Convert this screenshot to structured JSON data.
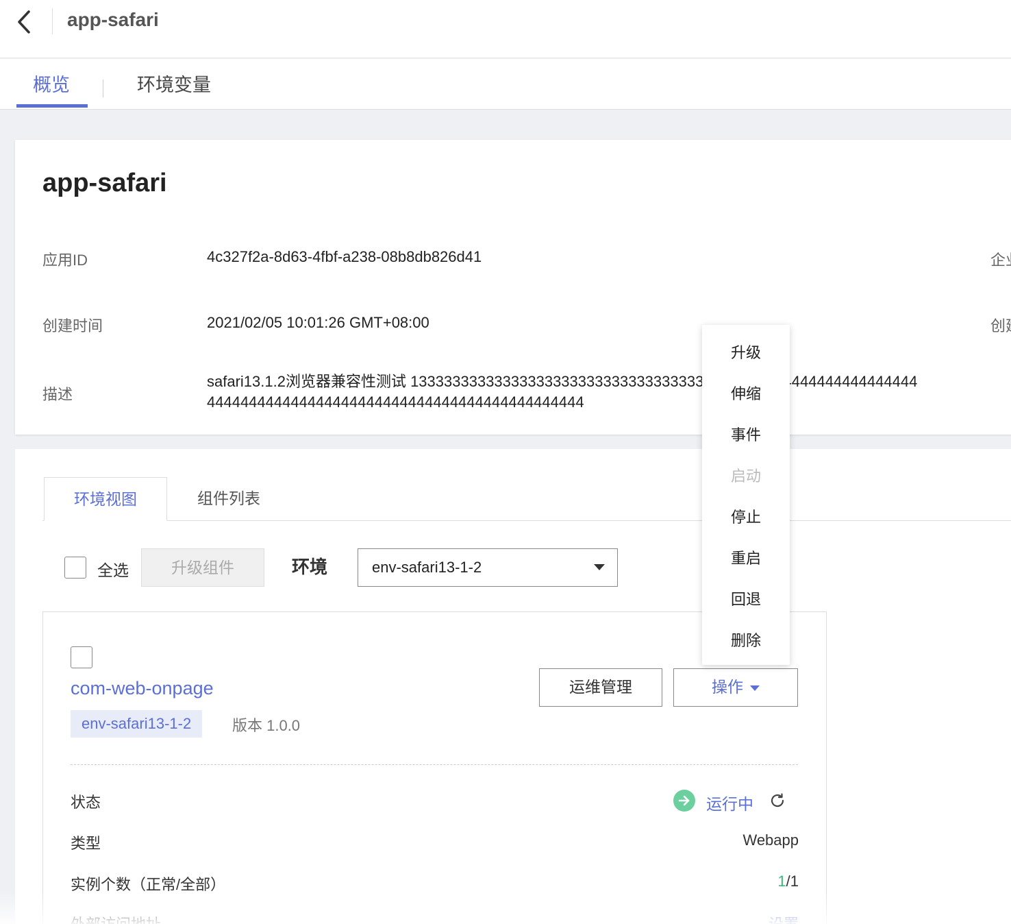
{
  "header": {
    "title": "app-safari"
  },
  "top_tabs": [
    {
      "label": "概览"
    },
    {
      "label": "环境变量"
    }
  ],
  "app": {
    "title": "app-safari",
    "fields": {
      "app_id_label": "应用ID",
      "app_id_value": "4c327f2a-8d63-4fbf-a238-08b8db826d41",
      "created_label": "创建时间",
      "created_value": "2021/02/05 10:01:26 GMT+08:00",
      "desc_label": "描述",
      "desc_value": "safari13.1.2浏览器兼容性测试 1333333333333333333333333333333333333333333 14444444444444444444444444444444444444444444444444444444444444"
    },
    "right_labels": {
      "row1": "企业",
      "row2": "创建"
    }
  },
  "sub_tabs": [
    {
      "label": "环境视图"
    },
    {
      "label": "组件列表"
    }
  ],
  "toolbar": {
    "select_all": "全选",
    "upgrade_btn": "升级组件",
    "env_label": "环境",
    "env_value": "env-safari13-1-2"
  },
  "component": {
    "name": "com-web-onpage",
    "env_tag": "env-safari13-1-2",
    "version": "版本 1.0.0",
    "ops_btn": "运维管理",
    "action_btn": "操作",
    "rows": {
      "status_label": "状态",
      "status_value": "运行中",
      "type_label": "类型",
      "type_value": "Webapp",
      "instances_label": "实例个数（正常/全部）",
      "instances_normal": "1",
      "instances_total": "/1",
      "access_label": "外部访问地址",
      "access_value": "设置"
    }
  },
  "action_menu": [
    {
      "label": "升级",
      "disabled": false
    },
    {
      "label": "伸缩",
      "disabled": false
    },
    {
      "label": "事件",
      "disabled": false
    },
    {
      "label": "启动",
      "disabled": true
    },
    {
      "label": "停止",
      "disabled": false
    },
    {
      "label": "重启",
      "disabled": false
    },
    {
      "label": "回退",
      "disabled": false
    },
    {
      "label": "删除",
      "disabled": false
    }
  ],
  "colors": {
    "accent": "#5b6fd6",
    "success": "#6ccf9e"
  }
}
